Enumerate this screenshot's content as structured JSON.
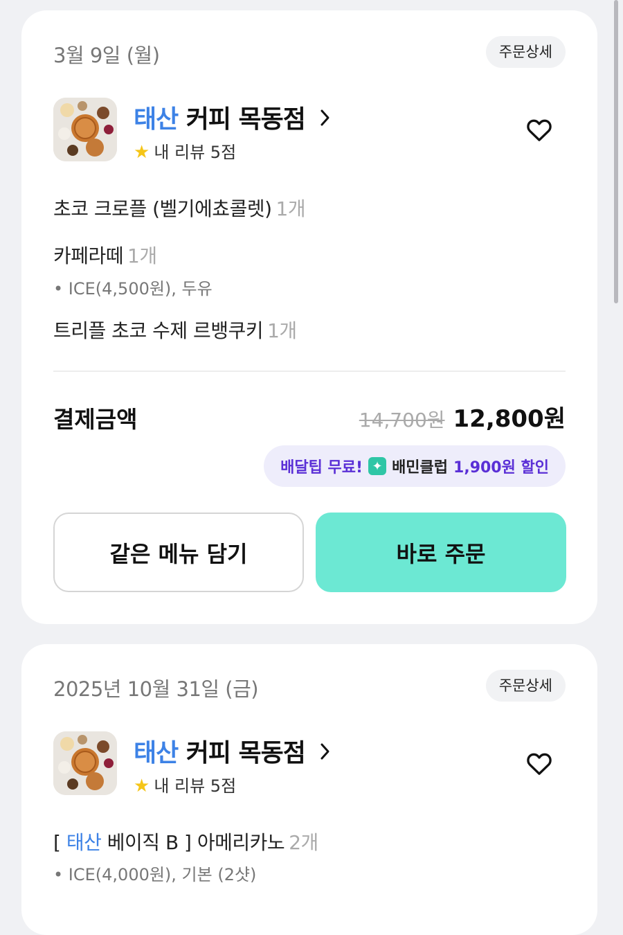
{
  "orders": [
    {
      "date": "3월 9일 (월)",
      "detail_label": "주문상세",
      "store_brand": "태산",
      "store_name": " 커피 목동점",
      "rating_text": "내 리뷰 5점",
      "items": [
        {
          "name": "초코 크로플 (벨기에쵸콜렛)",
          "qty": "1개"
        },
        {
          "name": "카페라떼",
          "qty": "1개",
          "option": "• ICE(4,500원), 두유"
        },
        {
          "name": "트리플 초코 수제 르뱅쿠키",
          "qty": "1개"
        }
      ],
      "payment_label": "결제금액",
      "original_price": "14,700원",
      "final_price": "12,800원",
      "promo": {
        "part1": "배달팁 무료!",
        "part2": "배민클럽",
        "part3": "1,900원 할인"
      },
      "buttons": {
        "same_menu": "같은 메뉴 담기",
        "order_now": "바로 주문"
      }
    },
    {
      "date": "2025년 10월 31일 (금)",
      "detail_label": "주문상세",
      "store_brand": "태산",
      "store_name": " 커피 목동점",
      "rating_text": "내 리뷰 5점",
      "items": [
        {
          "prefix_open": "[ ",
          "brand": "태산",
          "name": " 베이직 B ] 아메리카노",
          "qty": "2개",
          "option": "• ICE(4,000원), 기본 (2샷)"
        }
      ]
    }
  ],
  "colors": {
    "brand_blue": "#3d82e6",
    "mint": "#6ce8d3",
    "purple": "#5a2fd6"
  },
  "icons": {
    "chevron": "chevron-right-icon",
    "heart": "heart-outline-icon",
    "star": "star-icon"
  }
}
